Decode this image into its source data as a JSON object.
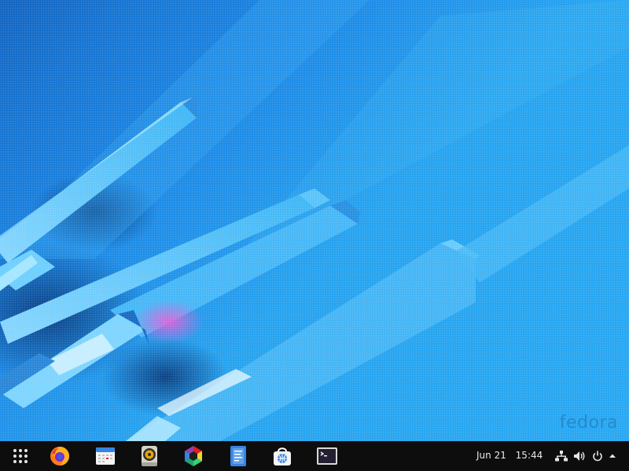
{
  "desktop": {
    "watermark": "fedora",
    "wallpaper_colors": {
      "sky": "#29a4ef",
      "deep": "#1565c0",
      "accent_pink": "#e060d8"
    }
  },
  "dock": {
    "background": "#0d0d0d",
    "items": [
      {
        "name": "app-grid-button",
        "icon": "app-grid-icon"
      },
      {
        "name": "firefox-launcher",
        "icon": "firefox-icon"
      },
      {
        "name": "calendar-launcher",
        "icon": "calendar-icon"
      },
      {
        "name": "rhythmbox-launcher",
        "icon": "speaker-icon"
      },
      {
        "name": "photos-launcher",
        "icon": "photos-icon"
      },
      {
        "name": "text-editor-launcher",
        "icon": "document-icon"
      },
      {
        "name": "software-launcher",
        "icon": "software-store-icon"
      },
      {
        "name": "terminal-launcher",
        "icon": "terminal-icon"
      }
    ],
    "clock": {
      "date": "Jun 21",
      "time": "15:44"
    },
    "tray": [
      "network-icon",
      "volume-icon",
      "power-icon",
      "menu-arrow-icon"
    ]
  }
}
